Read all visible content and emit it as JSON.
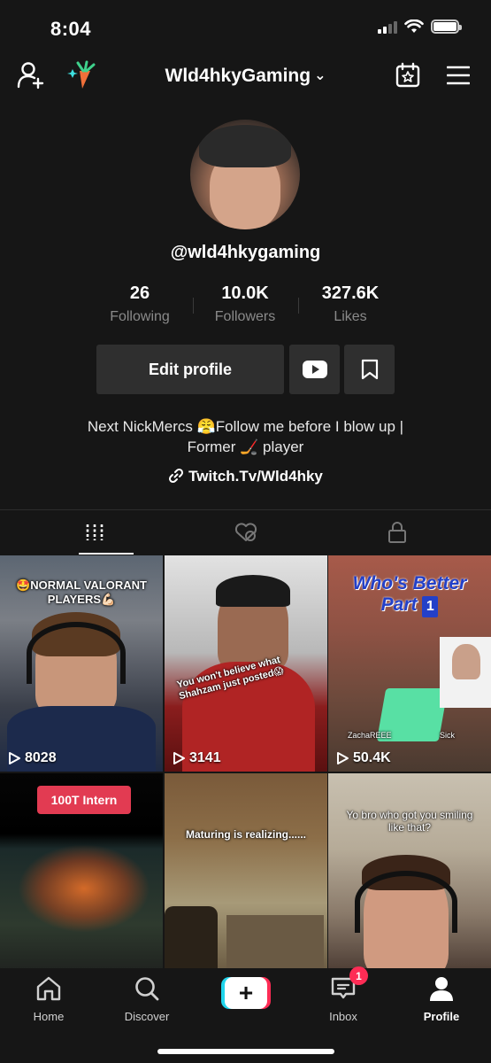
{
  "status_bar": {
    "time": "8:04"
  },
  "header": {
    "username": "Wld4hkyGaming"
  },
  "profile": {
    "handle": "@wld4hkygaming",
    "stats": [
      {
        "value": "26",
        "label": "Following"
      },
      {
        "value": "10.0K",
        "label": "Followers"
      },
      {
        "value": "327.6K",
        "label": "Likes"
      }
    ],
    "edit_label": "Edit profile",
    "bio_line1": "Next NickMercs 😤Follow me before I blow up |",
    "bio_line2": "Former 🏒 player",
    "link": "Twitch.Tv/Wld4hky"
  },
  "videos": [
    {
      "caption": "🤩NORMAL VALORANT PLAYERS💪🏻",
      "views": "8028"
    },
    {
      "caption": "You won't believe what Shahzam just posted😱",
      "views": "3141"
    },
    {
      "caption": "Who's Better Part",
      "part": "1",
      "names_left": "ZachaREEE",
      "names_right": "Sick",
      "views": "50.4K"
    },
    {
      "caption": "100T Intern",
      "views": ""
    },
    {
      "caption": "Maturing is realizing......",
      "views": ""
    },
    {
      "caption": "Yo bro who got you smiling like that?",
      "views": ""
    }
  ],
  "bottom_nav": {
    "home": "Home",
    "discover": "Discover",
    "inbox": "Inbox",
    "inbox_badge": "1",
    "profile": "Profile"
  },
  "colors": {
    "accent_red": "#fe2c55",
    "accent_cyan": "#20d5ec",
    "background": "#161616"
  }
}
